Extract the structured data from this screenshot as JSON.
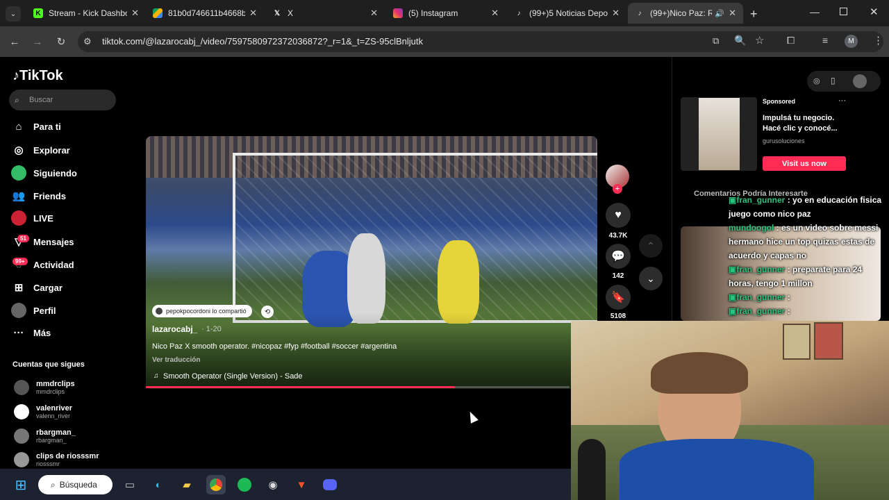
{
  "tabs": [
    {
      "title": "Stream - Kick Dashbo",
      "icon": "kick-icon",
      "color": "#53fc18"
    },
    {
      "title": "81b0d746611b4668b",
      "icon": "drive-icon",
      "color": "#f4b400"
    },
    {
      "title": "X",
      "icon": "x-icon",
      "color": "#ffffff"
    },
    {
      "title": "(5) Instagram",
      "icon": "instagram-icon",
      "color": "#e1306c"
    },
    {
      "title": "(99+)5 Noticias Depo",
      "icon": "tiktok-icon",
      "color": "#ffffff"
    },
    {
      "title": "(99+)Nico Paz: Ri",
      "icon": "tiktok-icon",
      "color": "#ffffff"
    }
  ],
  "address": {
    "url": "tiktok.com/@lazarocabj_/video/7597580972372036872?_r=1&_t=ZS-95clBnljutk"
  },
  "tiktok": {
    "logo": "TikTok",
    "search_placeholder": "Buscar",
    "nav": [
      {
        "label": "Para ti",
        "icon": "home-icon"
      },
      {
        "label": "Explorar",
        "icon": "compass-icon"
      },
      {
        "label": "Siguiendo",
        "icon": "following-icon"
      },
      {
        "label": "Friends",
        "icon": "friends-icon"
      },
      {
        "label": "LIVE",
        "icon": "live-icon"
      },
      {
        "label": "Mensajes",
        "icon": "messages-icon",
        "badge": "51"
      },
      {
        "label": "Actividad",
        "icon": "activity-icon",
        "badge": "99+"
      },
      {
        "label": "Cargar",
        "icon": "upload-icon"
      },
      {
        "label": "Perfil",
        "icon": "profile-icon"
      },
      {
        "label": "Más",
        "icon": "more-icon"
      }
    ],
    "following_header": "Cuentas que sigues",
    "following": [
      {
        "name": "mmdrclips",
        "user": "mmdrclips"
      },
      {
        "name": "valenriver",
        "user": "valenn_river"
      },
      {
        "name": "rbargman_",
        "user": "rbargman_"
      },
      {
        "name": "clips de riosssmr",
        "user": "riosssmr"
      }
    ]
  },
  "video": {
    "shared_by": "pepokpocordoni lo compartió",
    "author": "lazarocabj_",
    "date": "· 1-20",
    "caption": "Nico Paz X smooth operator. #nicopaz #fyp #football #soccer #argentina",
    "translate": "Ver traducción",
    "sound": "Smooth Operator (Single Version) - Sade",
    "progress": 0.73,
    "likes": "43.7K",
    "comments": "142",
    "saves": "5108"
  },
  "sponsored": {
    "label": "Sponsored",
    "text": "Impulsá tu negocio. Hacé clic y conocé...",
    "advertiser": "gurusoluciones",
    "button": "Visit us now"
  },
  "panel_tabs": "Comentarios Podría Interesarte",
  "chat": [
    {
      "user": "fran_gunner",
      "msg": ": yo en educación fisica juego como nico paz"
    },
    {
      "user": "mundoogol",
      "msg": ": es un video sobre messi hermano hice un top quizas estas de acuerdo y capas no"
    },
    {
      "user": "fran_gunner",
      "msg": ": preparate para 24 horas, tengo 1 millon"
    },
    {
      "user": "fran_gunner",
      "msg": ":"
    },
    {
      "user": "fran_gunner",
      "msg": ":"
    }
  ],
  "taskbar": {
    "search_label": "Búsqueda",
    "apps": [
      "taskview-icon",
      "edge-icon",
      "explorer-icon",
      "chrome-icon",
      "spotify-icon",
      "obs-icon",
      "brave-icon",
      "discord-icon"
    ]
  }
}
